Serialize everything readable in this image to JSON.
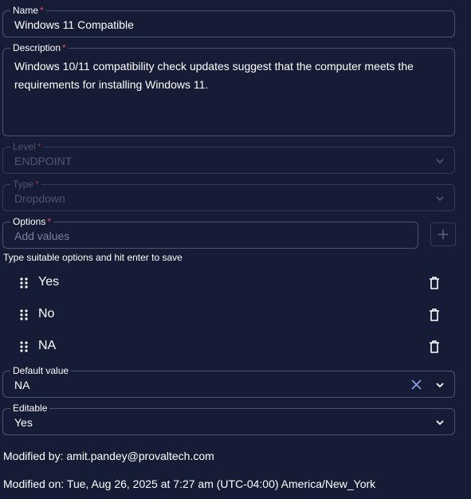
{
  "name": {
    "label": "Name",
    "value": "Windows 11 Compatible"
  },
  "description": {
    "label": "Description",
    "value": "Windows 10/11 compatibility check updates suggest that the computer meets the requirements for installing Windows 11."
  },
  "level": {
    "label": "Level",
    "value": "ENDPOINT"
  },
  "type": {
    "label": "Type",
    "value": "Dropdown"
  },
  "options": {
    "label": "Options",
    "placeholder": "Add values",
    "hint": "Type suitable options and hit enter to save",
    "items": [
      {
        "label": "Yes"
      },
      {
        "label": "No"
      },
      {
        "label": "NA"
      }
    ]
  },
  "default_value": {
    "label": "Default value",
    "value": "NA"
  },
  "editable": {
    "label": "Editable",
    "value": "Yes"
  },
  "modified_by": "Modified by: amit.pandey@provaltech.com",
  "modified_on": "Modified on: Tue, Aug 26, 2025 at 7:27 am (UTC-04:00) America/New_York",
  "required_marker": "*",
  "colors": {
    "background": "#161c36",
    "border": "#4a5275",
    "required": "#e04c5e",
    "clear_icon": "#8aa4e8"
  },
  "icons": [
    "chevron-down-icon",
    "plus-icon",
    "drag-handle-icon",
    "trash-icon",
    "clear-icon"
  ]
}
